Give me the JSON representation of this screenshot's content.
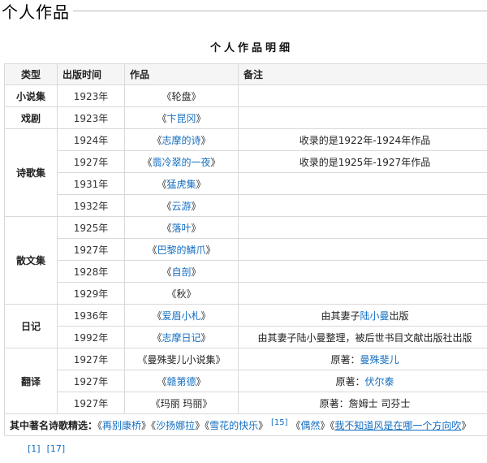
{
  "page_title": "个人作品",
  "table_title": "个人作品明细",
  "headers": [
    "类型",
    "出版时间",
    "作品",
    "备注"
  ],
  "rows": [
    {
      "type": "小说集",
      "year": "1923年",
      "work": "轮盘",
      "linked": false,
      "note": ""
    },
    {
      "type": "戏剧",
      "year": "1923年",
      "work": "卞昆冈",
      "linked": true,
      "note": ""
    },
    {
      "type": "诗歌集",
      "year": "1924年",
      "work": "志摩的诗",
      "linked": true,
      "note": "收录的是1922年-1924年作品"
    },
    {
      "type": "",
      "year": "1927年",
      "work": "翡冷翠的一夜",
      "linked": true,
      "note": "收录的是1925年-1927年作品"
    },
    {
      "type": "",
      "year": "1931年",
      "work": "猛虎集",
      "linked": true,
      "note": ""
    },
    {
      "type": "",
      "year": "1932年",
      "work": "云游",
      "linked": true,
      "note": ""
    },
    {
      "type": "散文集",
      "year": "1925年",
      "work": "落叶",
      "linked": true,
      "note": ""
    },
    {
      "type": "",
      "year": "1927年",
      "work": "巴黎的鳞爪",
      "linked": true,
      "note": ""
    },
    {
      "type": "",
      "year": "1928年",
      "work": "自剖",
      "linked": true,
      "note": ""
    },
    {
      "type": "",
      "year": "1929年",
      "work": "秋",
      "linked": false,
      "note": ""
    },
    {
      "type": "日记",
      "year": "1936年",
      "work": "爱眉小札",
      "linked": true,
      "note_pre": "由其妻子",
      "note_link": "陆小曼",
      "note_post": "出版"
    },
    {
      "type": "",
      "year": "1992年",
      "work": "志摩日记",
      "linked": true,
      "note": "由其妻子陆小曼整理，被后世书目文献出版社出版"
    },
    {
      "type": "翻译",
      "year": "1927年",
      "work": "曼殊斐儿小说集",
      "linked": false,
      "note_pre": "原著：",
      "note_link": "曼殊斐儿",
      "note_post": ""
    },
    {
      "type": "",
      "year": "1927年",
      "work": "赣第德",
      "linked": true,
      "note_pre": "原著：",
      "note_link": "伏尔泰",
      "note_post": ""
    },
    {
      "type": "",
      "year": "1927年",
      "work": "玛丽 玛丽",
      "linked": false,
      "note": "原著：詹姆士 司芬士"
    }
  ],
  "footer": {
    "label": "其中著名诗歌精选：",
    "poems": [
      "再别康桥",
      "沙扬娜拉",
      "雪花的快乐"
    ],
    "ref": "[15]",
    "poems2": [
      "偶然"
    ],
    "last": "我不知道风是在哪一个方向吹"
  },
  "refs": [
    "[1]",
    "[17]"
  ],
  "link_color": "#136ec2"
}
